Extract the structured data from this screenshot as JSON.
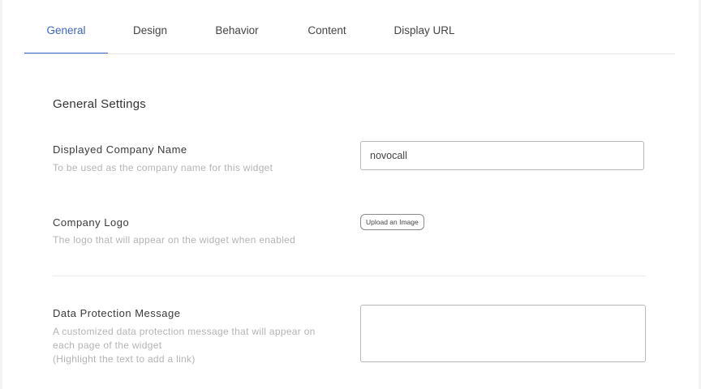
{
  "tabs": [
    {
      "label": "General",
      "active": true
    },
    {
      "label": "Design",
      "active": false
    },
    {
      "label": "Behavior",
      "active": false
    },
    {
      "label": "Content",
      "active": false
    },
    {
      "label": "Display URL",
      "active": false
    }
  ],
  "accent_color": "#3e64c8",
  "section": {
    "title": "General Settings"
  },
  "company_name": {
    "label": "Displayed Company Name",
    "help": "To be used as the company name for this widget",
    "value": "novocall"
  },
  "company_logo": {
    "label": "Company Logo",
    "help": "The logo that will appear on the widget when enabled",
    "button_label": "Upload an Image"
  },
  "data_protection": {
    "label": "Data Protection Message",
    "help_line1": "A customized data protection message that will appear on",
    "help_line2": "each page of the widget",
    "help_line3": "(Highlight the text to add a link)",
    "value": ""
  }
}
